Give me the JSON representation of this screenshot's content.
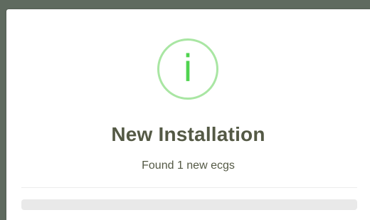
{
  "dialog": {
    "icon": "info-icon",
    "icon_glyph": "i",
    "title": "New Installation",
    "message": "Found 1 new ecgs",
    "progress": 0
  },
  "colors": {
    "icon_ring": "#a9e6a3",
    "icon_glyph": "#4fd34f",
    "text": "#545945",
    "backdrop": "#5f6a5f",
    "progress_track": "#e9e9e9"
  }
}
